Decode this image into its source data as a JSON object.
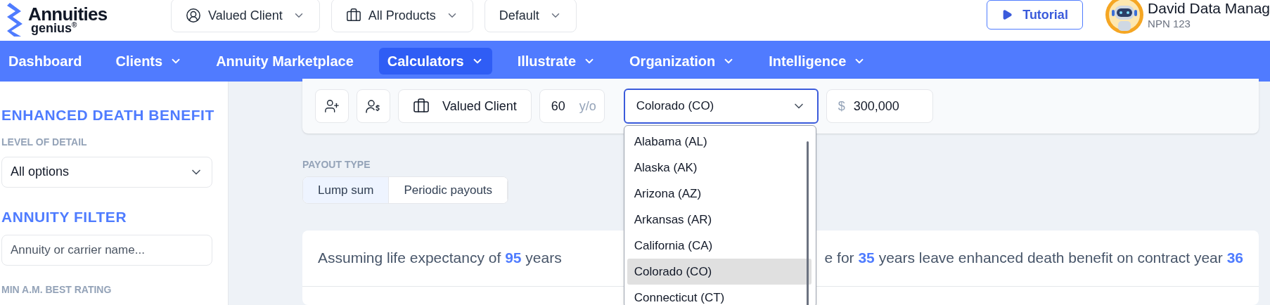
{
  "logo": {
    "line1": "Annuities",
    "line2": "genius",
    "mark": "®"
  },
  "selectors": [
    {
      "value": "Valued Client",
      "kind": "client"
    },
    {
      "value": "All Products",
      "kind": "products"
    },
    {
      "value": "Default",
      "kind": "plan"
    }
  ],
  "tutorial": {
    "label": "Tutorial"
  },
  "user": {
    "name": "David Data Manag",
    "subtitle": "NPN 123"
  },
  "nav": [
    {
      "label": "Dashboard",
      "has_menu": false,
      "selected": false
    },
    {
      "label": "Clients",
      "has_menu": true,
      "selected": false
    },
    {
      "label": "Annuity Marketplace",
      "has_menu": false,
      "selected": false
    },
    {
      "label": "Calculators",
      "has_menu": true,
      "selected": true
    },
    {
      "label": "Illustrate",
      "has_menu": true,
      "selected": false
    },
    {
      "label": "Organization",
      "has_menu": true,
      "selected": false
    },
    {
      "label": "Intelligence",
      "has_menu": true,
      "selected": false
    }
  ],
  "sidebar": {
    "sections": [
      {
        "title": "ENHANCED DEATH BENEFIT",
        "field_label": "LEVEL OF DETAIL",
        "field": {
          "kind": "select",
          "value": "All options"
        }
      },
      {
        "title": "ANNUITY FILTER",
        "field": {
          "kind": "search",
          "placeholder": "Annuity or carrier name..."
        }
      }
    ],
    "next_label": "MIN A.M. BEST RATING"
  },
  "toolbar": {
    "client": "Valued Client",
    "age": "60",
    "age_unit": "y/o",
    "state": "Colorado (CO)",
    "currency": "$",
    "amount": "300,000"
  },
  "state_options": [
    {
      "label": "Alabama (AL)",
      "selected": false
    },
    {
      "label": "Alaska (AK)",
      "selected": false
    },
    {
      "label": "Arizona (AZ)",
      "selected": false
    },
    {
      "label": "Arkansas (AR)",
      "selected": false
    },
    {
      "label": "California (CA)",
      "selected": false
    },
    {
      "label": "Colorado (CO)",
      "selected": true
    },
    {
      "label": "Connecticut (CT)",
      "selected": false
    }
  ],
  "payout": {
    "label": "PAYOUT TYPE",
    "options": [
      {
        "label": "Lump sum",
        "selected": true
      },
      {
        "label": "Periodic payouts",
        "selected": false
      }
    ]
  },
  "result": {
    "left": [
      {
        "text": "Assuming life expectancy of ",
        "highlight": false
      },
      {
        "text": "95",
        "highlight": true
      },
      {
        "text": " years",
        "highlight": false
      }
    ],
    "right": [
      {
        "text": "e for ",
        "highlight": false
      },
      {
        "text": "35",
        "highlight": true
      },
      {
        "text": " years leave enhanced death benefit on contract year ",
        "highlight": false
      },
      {
        "text": "36",
        "highlight": true
      }
    ]
  }
}
